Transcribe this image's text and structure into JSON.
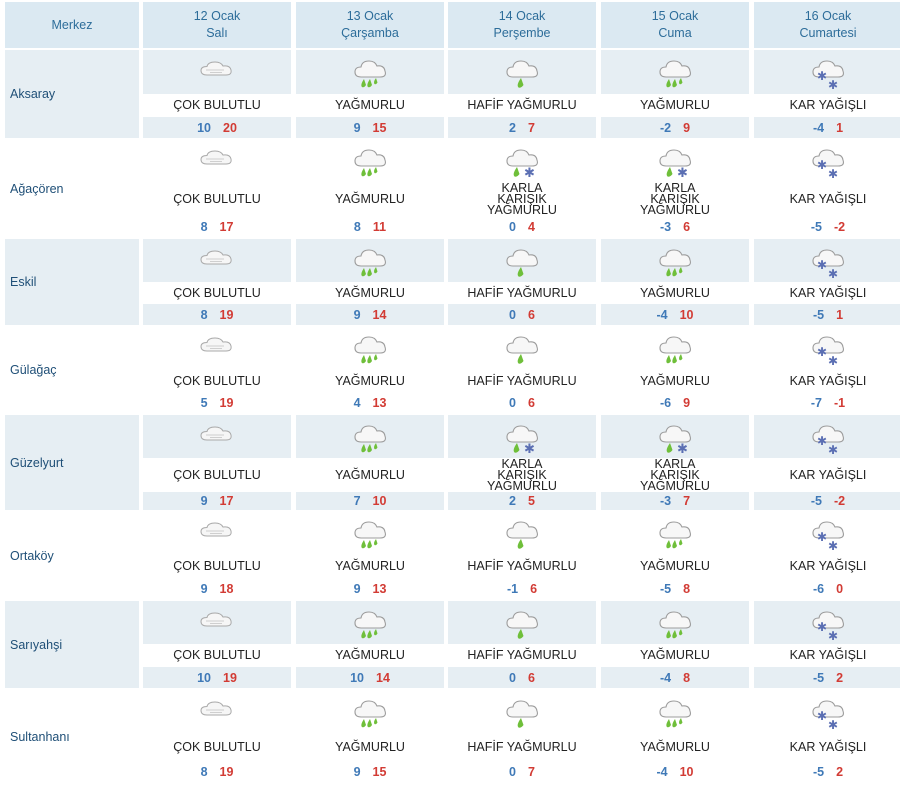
{
  "header": {
    "merkez": "Merkez",
    "days": [
      {
        "date": "12 Ocak",
        "weekday": "Salı"
      },
      {
        "date": "13 Ocak",
        "weekday": "Çarşamba"
      },
      {
        "date": "14 Ocak",
        "weekday": "Perşembe"
      },
      {
        "date": "15 Ocak",
        "weekday": "Cuma"
      },
      {
        "date": "16 Ocak",
        "weekday": "Cumartesi"
      }
    ]
  },
  "colors": {
    "header_bg": "#dbe9f2",
    "shaded_bg": "#e6eef3",
    "min_temp": "#3f79b7",
    "max_temp": "#d23b34",
    "header_text": "#2d6d9a"
  },
  "rows": [
    {
      "name": "Aksaray",
      "days": [
        {
          "icon": "cloudy-icon",
          "condition": "ÇOK BULUTLU",
          "min": "10",
          "max": "20"
        },
        {
          "icon": "rain-icon",
          "condition": "YAĞMURLU",
          "min": "9",
          "max": "15"
        },
        {
          "icon": "light-rain-icon",
          "condition": "HAFİF YAĞMURLU",
          "min": "2",
          "max": "7"
        },
        {
          "icon": "rain-icon",
          "condition": "YAĞMURLU",
          "min": "-2",
          "max": "9"
        },
        {
          "icon": "snow-icon",
          "condition": "KAR YAĞIŞLI",
          "min": "-4",
          "max": "1"
        }
      ]
    },
    {
      "name": "Ağaçören",
      "days": [
        {
          "icon": "cloudy-icon",
          "condition": "ÇOK BULUTLU",
          "min": "8",
          "max": "17"
        },
        {
          "icon": "rain-icon",
          "condition": "YAĞMURLU",
          "min": "8",
          "max": "11"
        },
        {
          "icon": "sleet-icon",
          "condition": "KARLA KARIŞIK YAĞMURLU",
          "min": "0",
          "max": "4"
        },
        {
          "icon": "sleet-icon",
          "condition": "KARLA KARIŞIK YAĞMURLU",
          "min": "-3",
          "max": "6"
        },
        {
          "icon": "snow-icon",
          "condition": "KAR YAĞIŞLI",
          "min": "-5",
          "max": "-2"
        }
      ]
    },
    {
      "name": "Eskil",
      "days": [
        {
          "icon": "cloudy-icon",
          "condition": "ÇOK BULUTLU",
          "min": "8",
          "max": "19"
        },
        {
          "icon": "rain-icon",
          "condition": "YAĞMURLU",
          "min": "9",
          "max": "14"
        },
        {
          "icon": "light-rain-icon",
          "condition": "HAFİF YAĞMURLU",
          "min": "0",
          "max": "6"
        },
        {
          "icon": "rain-icon",
          "condition": "YAĞMURLU",
          "min": "-4",
          "max": "10"
        },
        {
          "icon": "snow-icon",
          "condition": "KAR YAĞIŞLI",
          "min": "-5",
          "max": "1"
        }
      ]
    },
    {
      "name": "Gülağaç",
      "days": [
        {
          "icon": "cloudy-icon",
          "condition": "ÇOK BULUTLU",
          "min": "5",
          "max": "19"
        },
        {
          "icon": "rain-icon",
          "condition": "YAĞMURLU",
          "min": "4",
          "max": "13"
        },
        {
          "icon": "light-rain-icon",
          "condition": "HAFİF YAĞMURLU",
          "min": "0",
          "max": "6"
        },
        {
          "icon": "rain-icon",
          "condition": "YAĞMURLU",
          "min": "-6",
          "max": "9"
        },
        {
          "icon": "snow-icon",
          "condition": "KAR YAĞIŞLI",
          "min": "-7",
          "max": "-1"
        }
      ]
    },
    {
      "name": "Güzelyurt",
      "days": [
        {
          "icon": "cloudy-icon",
          "condition": "ÇOK BULUTLU",
          "min": "9",
          "max": "17"
        },
        {
          "icon": "rain-icon",
          "condition": "YAĞMURLU",
          "min": "7",
          "max": "10"
        },
        {
          "icon": "sleet-icon",
          "condition": "KARLA KARIŞIK YAĞMURLU",
          "min": "2",
          "max": "5"
        },
        {
          "icon": "sleet-icon",
          "condition": "KARLA KARIŞIK YAĞMURLU",
          "min": "-3",
          "max": "7"
        },
        {
          "icon": "snow-icon",
          "condition": "KAR YAĞIŞLI",
          "min": "-5",
          "max": "-2"
        }
      ]
    },
    {
      "name": "Ortaköy",
      "days": [
        {
          "icon": "cloudy-icon",
          "condition": "ÇOK BULUTLU",
          "min": "9",
          "max": "18"
        },
        {
          "icon": "rain-icon",
          "condition": "YAĞMURLU",
          "min": "9",
          "max": "13"
        },
        {
          "icon": "light-rain-icon",
          "condition": "HAFİF YAĞMURLU",
          "min": "-1",
          "max": "6"
        },
        {
          "icon": "rain-icon",
          "condition": "YAĞMURLU",
          "min": "-5",
          "max": "8"
        },
        {
          "icon": "snow-icon",
          "condition": "KAR YAĞIŞLI",
          "min": "-6",
          "max": "0"
        }
      ]
    },
    {
      "name": "Sarıyahşi",
      "days": [
        {
          "icon": "cloudy-icon",
          "condition": "ÇOK BULUTLU",
          "min": "10",
          "max": "19"
        },
        {
          "icon": "rain-icon",
          "condition": "YAĞMURLU",
          "min": "10",
          "max": "14"
        },
        {
          "icon": "light-rain-icon",
          "condition": "HAFİF YAĞMURLU",
          "min": "0",
          "max": "6"
        },
        {
          "icon": "rain-icon",
          "condition": "YAĞMURLU",
          "min": "-4",
          "max": "8"
        },
        {
          "icon": "snow-icon",
          "condition": "KAR YAĞIŞLI",
          "min": "-5",
          "max": "2"
        }
      ]
    },
    {
      "name": "Sultanhanı",
      "days": [
        {
          "icon": "cloudy-icon",
          "condition": "ÇOK BULUTLU",
          "min": "8",
          "max": "19"
        },
        {
          "icon": "rain-icon",
          "condition": "YAĞMURLU",
          "min": "9",
          "max": "15"
        },
        {
          "icon": "light-rain-icon",
          "condition": "HAFİF YAĞMURLU",
          "min": "0",
          "max": "7"
        },
        {
          "icon": "rain-icon",
          "condition": "YAĞMURLU",
          "min": "-4",
          "max": "10"
        },
        {
          "icon": "snow-icon",
          "condition": "KAR YAĞIŞLI",
          "min": "-5",
          "max": "2"
        }
      ]
    }
  ]
}
